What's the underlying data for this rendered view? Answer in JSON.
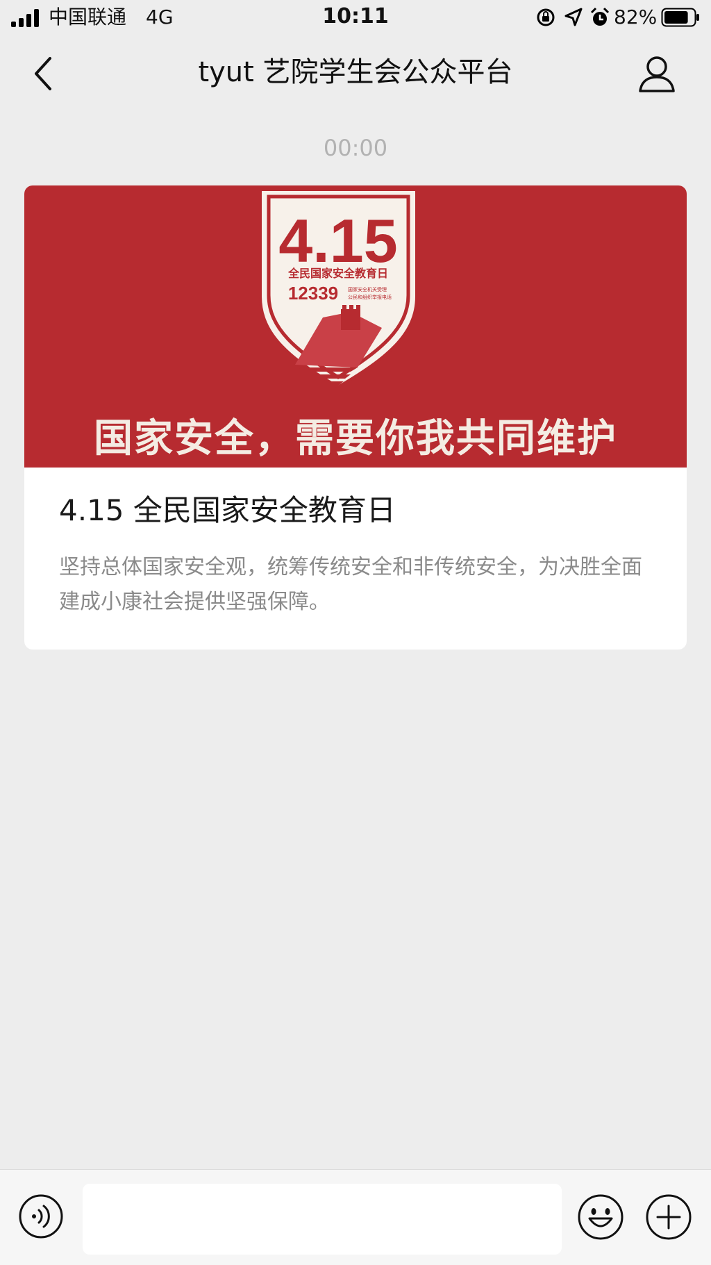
{
  "status_bar": {
    "carrier": "中国联通",
    "network": "4G",
    "time": "10:11",
    "battery_percent": "82%",
    "battery_level": 0.82
  },
  "nav": {
    "title": "tyut 艺院学生会公众平台",
    "back_icon": "chevron-left-icon",
    "profile_icon": "person-icon"
  },
  "message": {
    "timestamp": "00:00",
    "card": {
      "banner": {
        "badge_number": "4.15",
        "badge_subtitle": "全民国家安全教育日",
        "badge_hotline": "12339",
        "badge_hotline_note_1": "国家安全机关受理",
        "badge_hotline_note_2": "公民和组织举报电话",
        "slogan": "国家安全，需要你我共同维护",
        "background_color": "#b72b30"
      },
      "title": "4.15 全民国家安全教育日",
      "description": "坚持总体国家安全观，统筹传统安全和非传统安全，为决胜全面建成小康社会提供坚强保障。"
    }
  },
  "input_bar": {
    "voice_icon": "voice-icon",
    "input_value": "",
    "emoji_icon": "emoji-icon",
    "plus_icon": "plus-icon"
  }
}
